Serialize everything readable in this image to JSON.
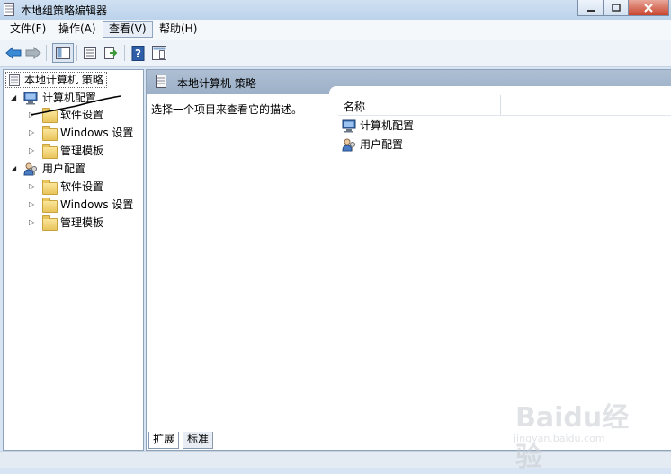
{
  "window": {
    "title": "本地组策略编辑器",
    "icon": "document-icon",
    "controls": [
      "minimize",
      "maximize",
      "close"
    ]
  },
  "menu": {
    "items": [
      {
        "label": "文件(F)"
      },
      {
        "label": "操作(A)"
      },
      {
        "label": "查看(V)",
        "active": true
      },
      {
        "label": "帮助(H)"
      }
    ]
  },
  "toolbar": {
    "buttons": [
      "back-arrow-icon",
      "forward-arrow-icon",
      "show-tree-icon",
      "properties-icon",
      "export-list-icon",
      "help-icon",
      "extended-view-icon"
    ]
  },
  "tree": {
    "root": "本地计算机 策略",
    "computer_config": "计算机配置",
    "user_config": "用户配置",
    "computer_children": [
      "软件设置",
      "Windows 设置",
      "管理模板"
    ],
    "user_children": [
      "软件设置",
      "Windows 设置",
      "管理模板"
    ]
  },
  "right_pane": {
    "header_title": "本地计算机 策略",
    "description": "选择一个项目来查看它的描述。",
    "column_name": "名称",
    "rows": [
      "计算机配置",
      "用户配置"
    ]
  },
  "tabs": [
    "扩展",
    "标准"
  ],
  "watermark": {
    "big": "Baidu经验",
    "small": "jingyan.baidu.com"
  },
  "colors": {
    "title_bar": "#c4d8ee",
    "header_band": "#a4b7cd",
    "folder": "#f2d27a"
  }
}
